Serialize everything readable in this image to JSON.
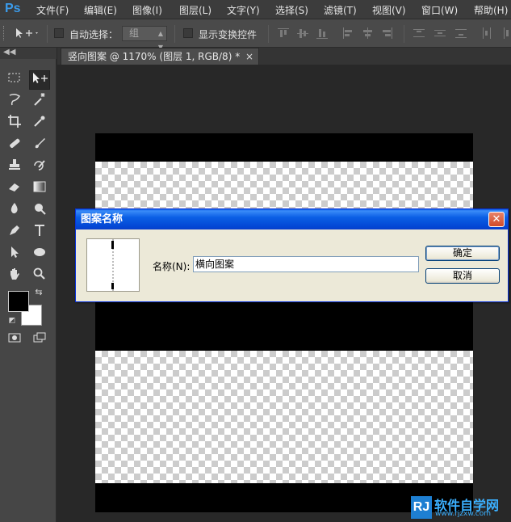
{
  "app": {
    "logo": "Ps"
  },
  "menu": [
    "文件(F)",
    "编辑(E)",
    "图像(I)",
    "图层(L)",
    "文字(Y)",
    "选择(S)",
    "滤镜(T)",
    "视图(V)",
    "窗口(W)",
    "帮助(H)"
  ],
  "options": {
    "tool_icon": "move-icon",
    "auto_select_label": "自动选择：",
    "auto_select_value": "组",
    "show_transform_label": "显示变换控件"
  },
  "toolbox": {
    "collapse": "◀◀",
    "tools": [
      "marquee-icon",
      "move-icon",
      "lasso-icon",
      "magic-wand-icon",
      "crop-icon",
      "eyedropper-icon",
      "healing-brush-icon",
      "brush-icon",
      "clone-stamp-icon",
      "history-brush-icon",
      "eraser-icon",
      "gradient-icon",
      "blur-icon",
      "dodge-icon",
      "pen-icon",
      "type-icon",
      "path-selection-icon",
      "ellipse-icon",
      "hand-icon",
      "zoom-icon"
    ],
    "foreground_color": "#000000",
    "background_color": "#ffffff"
  },
  "document": {
    "tab_title": "竖向图案 @ 1170% (图层 1, RGB/8) *",
    "close": "×"
  },
  "dialog": {
    "title": "图案名称",
    "close": "✕",
    "name_label": "名称(N):",
    "name_value": "横向图案",
    "ok_label": "确定",
    "cancel_label": "取消"
  },
  "watermark": {
    "logo": "RJ",
    "text": "软件自学网",
    "url": "www.rjzxw.com"
  },
  "colors": {
    "dialog_title": "#0a4fd8",
    "ps_blue": "#3b9bea"
  }
}
